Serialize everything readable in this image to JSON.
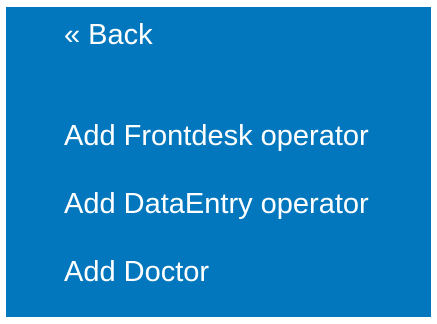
{
  "sidebar": {
    "background_color": "#0277bd",
    "text_color": "#ffffff",
    "back_label": "« Back",
    "items": [
      {
        "label": "Add Frontdesk operator"
      },
      {
        "label": "Add DataEntry operator"
      },
      {
        "label": "Add Doctor"
      }
    ]
  }
}
